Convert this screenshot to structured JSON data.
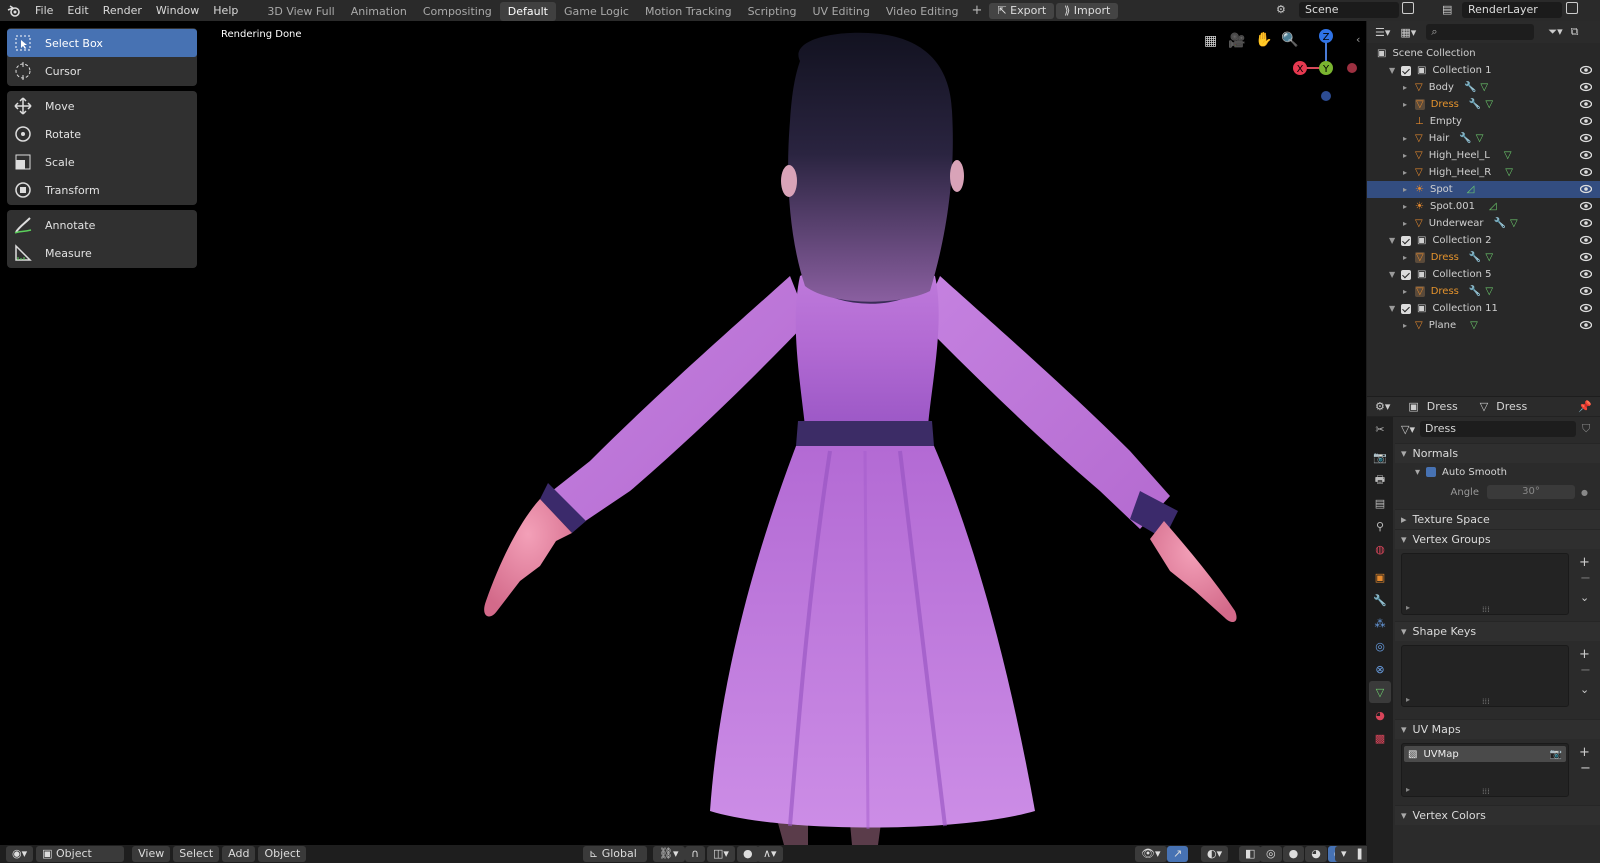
{
  "menu": [
    "File",
    "Edit",
    "Render",
    "Window",
    "Help"
  ],
  "workspaces": [
    {
      "label": "3D View Full",
      "active": false
    },
    {
      "label": "Animation",
      "active": false
    },
    {
      "label": "Compositing",
      "active": false
    },
    {
      "label": "Default",
      "active": true
    },
    {
      "label": "Game Logic",
      "active": false
    },
    {
      "label": "Motion Tracking",
      "active": false
    },
    {
      "label": "Scripting",
      "active": false
    },
    {
      "label": "UV Editing",
      "active": false
    },
    {
      "label": "Video Editing",
      "active": false
    }
  ],
  "topbar": {
    "export": "Export",
    "import": "Import",
    "scene": "Scene",
    "view_layer": "RenderLayer"
  },
  "tools": {
    "group1": [
      {
        "label": "Select Box",
        "icon": "select-box-icon",
        "active": true
      },
      {
        "label": "Cursor",
        "icon": "cursor-icon",
        "active": false
      }
    ],
    "group2": [
      {
        "label": "Move",
        "icon": "move-icon"
      },
      {
        "label": "Rotate",
        "icon": "rotate-icon"
      },
      {
        "label": "Scale",
        "icon": "scale-icon"
      },
      {
        "label": "Transform",
        "icon": "transform-icon"
      }
    ],
    "group3": [
      {
        "label": "Annotate",
        "icon": "annotate-icon"
      },
      {
        "label": "Measure",
        "icon": "measure-icon"
      }
    ]
  },
  "viewport": {
    "status": "Rendering Done"
  },
  "gizmo": {
    "z": "Z",
    "y": "Y",
    "x": "X"
  },
  "bottombar": {
    "mode": "Object Mode",
    "view": "View",
    "select": "Select",
    "add": "Add",
    "object": "Object",
    "orientation": "Global"
  },
  "outliner": {
    "root": "Scene Collection",
    "rows": [
      {
        "label": "Collection 1",
        "type": "collection",
        "depth": 1,
        "selected": false,
        "highlight": false
      },
      {
        "label": "Body",
        "type": "mesh",
        "depth": 2,
        "selected": false,
        "highlight": false,
        "mod": true
      },
      {
        "label": "Dress",
        "type": "mesh-active",
        "depth": 2,
        "selected": false,
        "highlight": true,
        "mod": true
      },
      {
        "label": "Empty",
        "type": "empty",
        "depth": 2,
        "selected": false,
        "highlight": false,
        "mod": false
      },
      {
        "label": "Hair",
        "type": "mesh",
        "depth": 2,
        "selected": false,
        "highlight": false,
        "mod": true
      },
      {
        "label": "High_Heel_L",
        "type": "mesh",
        "depth": 2,
        "selected": false,
        "highlight": false,
        "mod": false
      },
      {
        "label": "High_Heel_R",
        "type": "mesh",
        "depth": 2,
        "selected": false,
        "highlight": false,
        "mod": false
      },
      {
        "label": "Spot",
        "type": "light",
        "depth": 2,
        "selected": true,
        "highlight": false,
        "mod": false
      },
      {
        "label": "Spot.001",
        "type": "light",
        "depth": 2,
        "selected": false,
        "highlight": false,
        "mod": false
      },
      {
        "label": "Underwear",
        "type": "mesh",
        "depth": 2,
        "selected": false,
        "highlight": false,
        "mod": true
      },
      {
        "label": "Collection 2",
        "type": "collection",
        "depth": 1,
        "selected": false,
        "highlight": false
      },
      {
        "label": "Dress",
        "type": "mesh-active",
        "depth": 2,
        "selected": false,
        "highlight": true,
        "mod": true
      },
      {
        "label": "Collection 5",
        "type": "collection",
        "depth": 1,
        "selected": false,
        "highlight": false
      },
      {
        "label": "Dress",
        "type": "mesh-active",
        "depth": 2,
        "selected": false,
        "highlight": true,
        "mod": true
      },
      {
        "label": "Collection 11",
        "type": "collection",
        "depth": 1,
        "selected": false,
        "highlight": false
      },
      {
        "label": "Plane",
        "type": "mesh",
        "depth": 2,
        "selected": false,
        "highlight": false,
        "mod": false
      }
    ]
  },
  "properties": {
    "object_name": "Dress",
    "data_name": "Dress",
    "mesh_field": "Dress",
    "normals": "Normals",
    "auto_smooth": "Auto Smooth",
    "angle_label": "Angle",
    "angle_value": "30°",
    "texture_space": "Texture Space",
    "vertex_groups": "Vertex Groups",
    "shape_keys": "Shape Keys",
    "uv_maps": "UV Maps",
    "uvmap_item": "UVMap",
    "vertex_colors": "Vertex Colors"
  }
}
